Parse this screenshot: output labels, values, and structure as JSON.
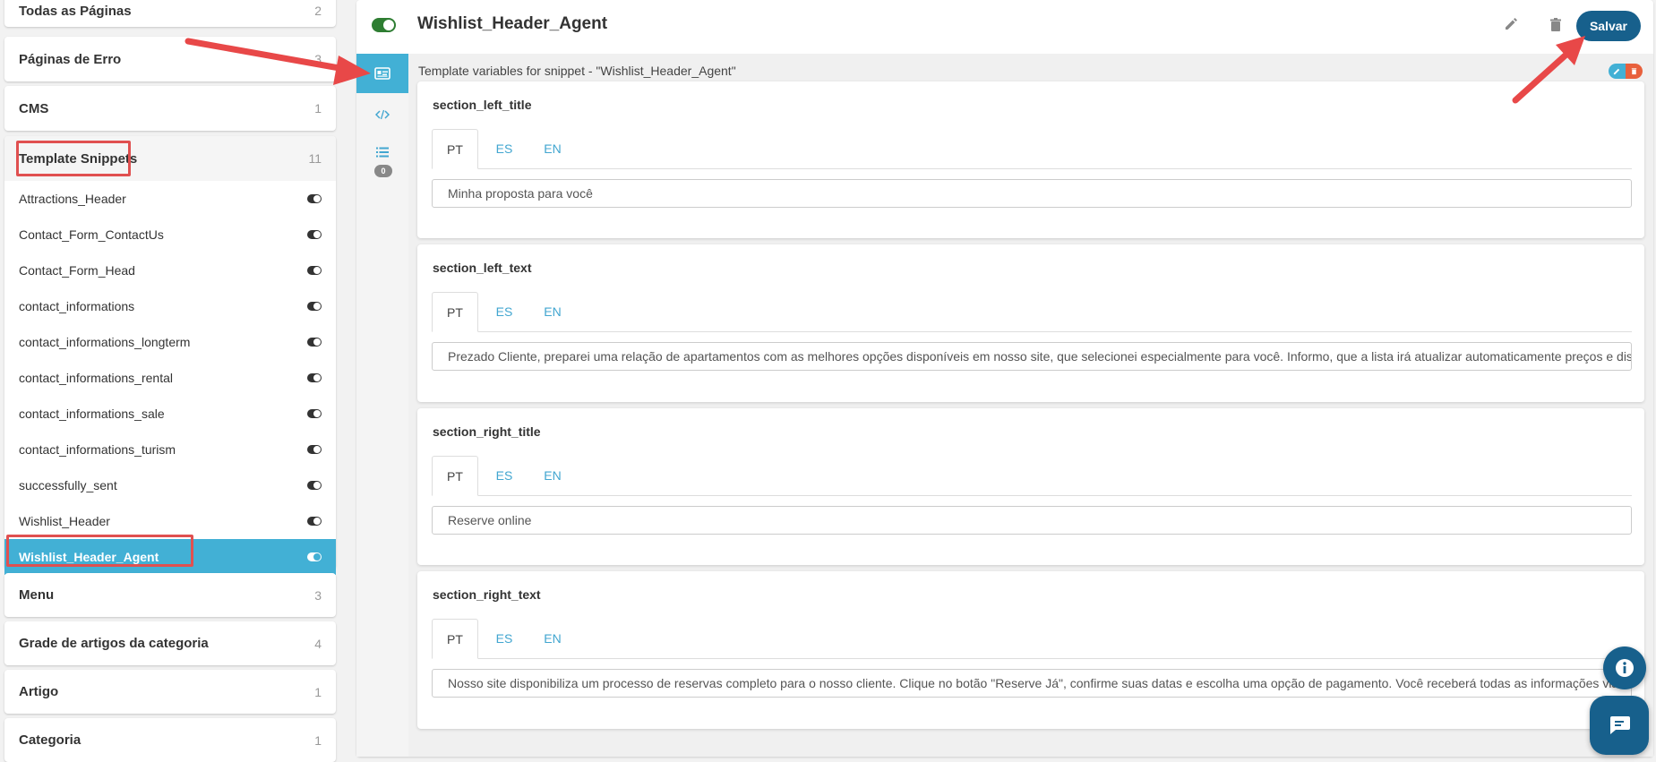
{
  "sidebar": {
    "groups_top": [
      {
        "label": "Todas as Páginas",
        "count": "2"
      },
      {
        "label": "Páginas de Erro",
        "count": "3"
      },
      {
        "label": "CMS",
        "count": "1"
      }
    ],
    "snippets_group": {
      "label": "Template Snippets",
      "count": "11",
      "items": [
        {
          "label": "Attractions_Header",
          "enabled": true
        },
        {
          "label": "Contact_Form_ContactUs",
          "enabled": true
        },
        {
          "label": "Contact_Form_Head",
          "enabled": true
        },
        {
          "label": "contact_informations",
          "enabled": true
        },
        {
          "label": "contact_informations_longterm",
          "enabled": true
        },
        {
          "label": "contact_informations_rental",
          "enabled": true
        },
        {
          "label": "contact_informations_sale",
          "enabled": true
        },
        {
          "label": "contact_informations_turism",
          "enabled": true
        },
        {
          "label": "successfully_sent",
          "enabled": true
        },
        {
          "label": "Wishlist_Header",
          "enabled": true
        },
        {
          "label": "Wishlist_Header_Agent",
          "enabled": true,
          "selected": true
        }
      ]
    },
    "groups_bottom": [
      {
        "label": "Menu",
        "count": "3"
      },
      {
        "label": "Grade de artigos da categoria",
        "count": "4"
      },
      {
        "label": "Artigo",
        "count": "1"
      },
      {
        "label": "Categoria",
        "count": "1"
      }
    ]
  },
  "header": {
    "title": "Wishlist_Header_Agent",
    "enabled": true,
    "save_label": "Salvar",
    "icons": [
      "pencil-icon",
      "trash-icon"
    ]
  },
  "rail": {
    "items": [
      "id-card-icon",
      "code-icon",
      "list-icon"
    ],
    "badge": "0"
  },
  "content": {
    "heading": "Template variables for snippet - \"Wishlist_Header_Agent\"",
    "tabs": [
      "PT",
      "ES",
      "EN"
    ],
    "active_tab": "PT",
    "variables": [
      {
        "name": "section_left_title",
        "value": "Minha proposta para você"
      },
      {
        "name": "section_left_text",
        "value": "Prezado Cliente, preparei uma relação de apartamentos com as melhores opções disponíveis em nosso site, que selecionei especialmente para você. Informo, que a lista irá atualizar automaticamente preços e disponib"
      },
      {
        "name": "section_right_title",
        "value": "Reserve online"
      },
      {
        "name": "section_right_text",
        "value": "Nosso site disponibiliza um processo de reservas completo para o nosso cliente. Clique no botão \"Reserve Já\", confirme suas datas e escolha uma opção de pagamento. Você receberá todas as informações via e-mail"
      }
    ]
  },
  "colors": {
    "accent": "#42b0d5",
    "primary": "#17608c",
    "annotation": "#e84848",
    "toggle_on": "#2e7d32"
  }
}
